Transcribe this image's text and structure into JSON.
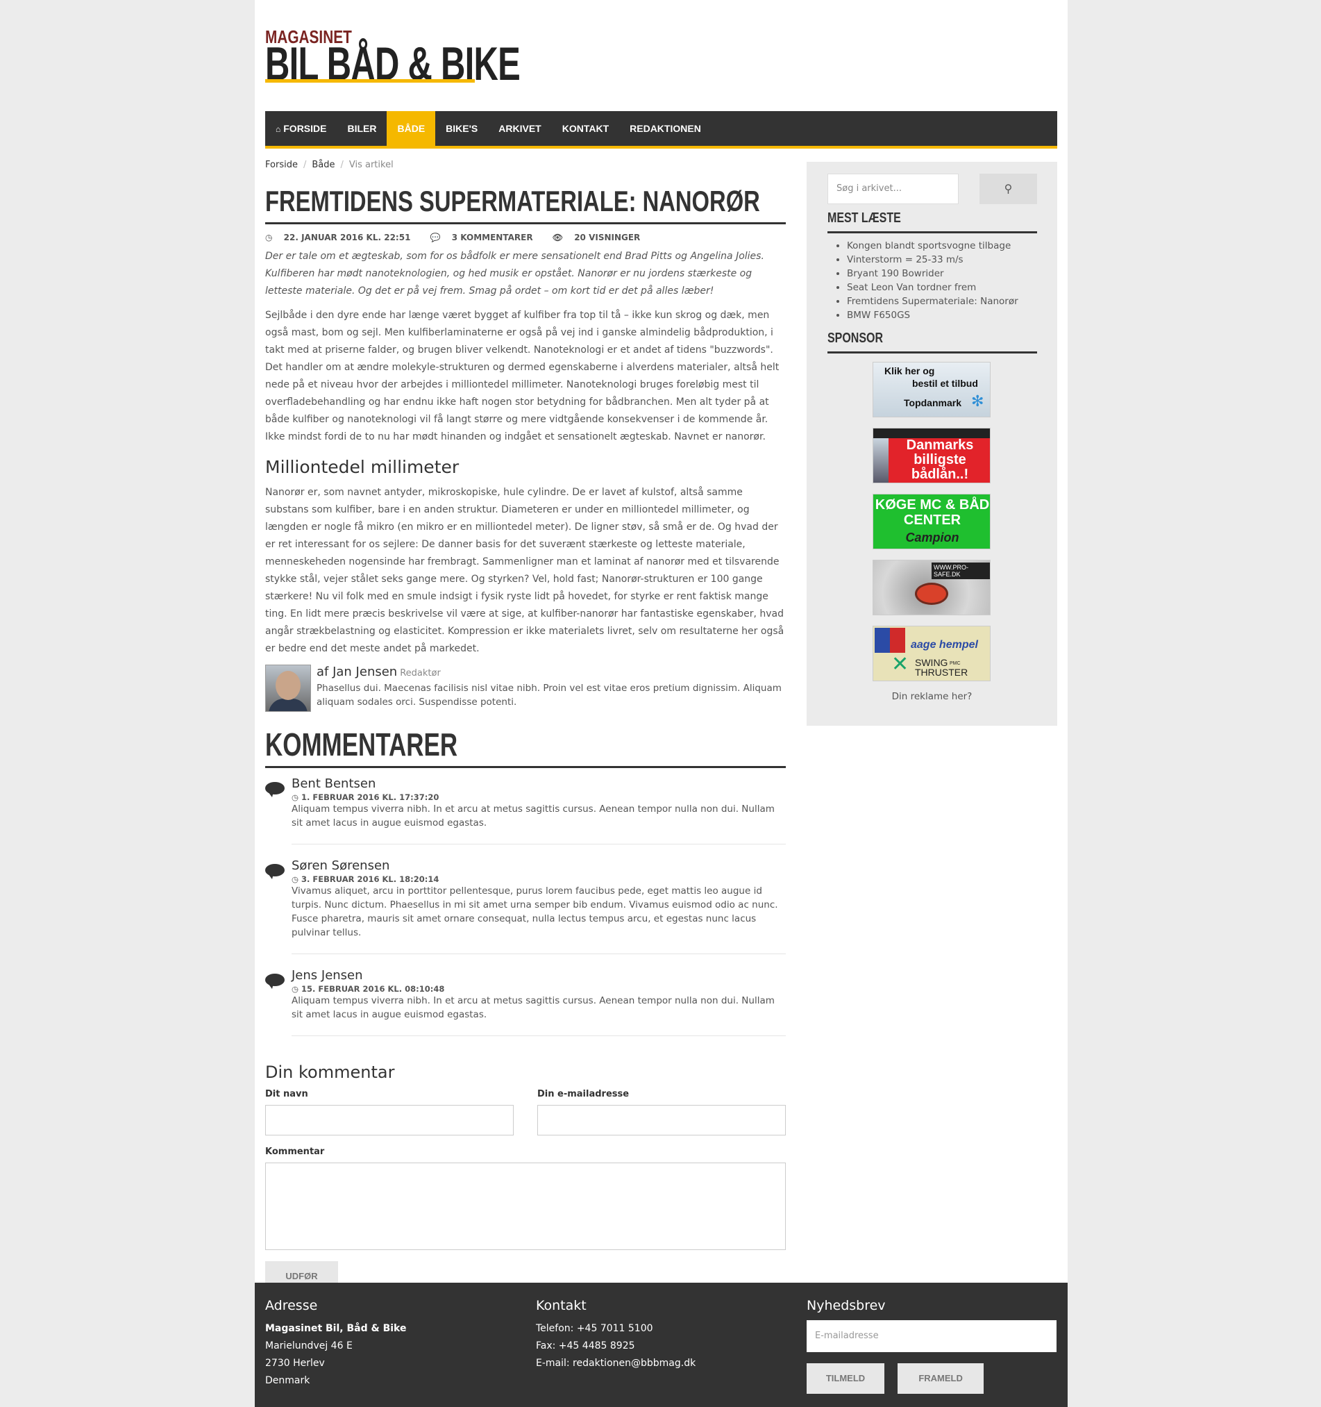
{
  "logo": {
    "small": "MAGASINET",
    "big": "BIL BÅD & BIKE"
  },
  "nav": [
    {
      "label": "FORSIDE",
      "icon": "home-icon",
      "active": false
    },
    {
      "label": "BILER",
      "active": false
    },
    {
      "label": "BÅDE",
      "active": true
    },
    {
      "label": "BIKE'S",
      "active": false
    },
    {
      "label": "ARKIVET",
      "active": false
    },
    {
      "label": "KONTAKT",
      "active": false
    },
    {
      "label": "REDAKTIONEN",
      "active": false
    }
  ],
  "breadcrumb": {
    "home": "Forside",
    "section": "Både",
    "current": "Vis artikel"
  },
  "article": {
    "title": "FREMTIDENS SUPERMATERIALE: NANORØR",
    "date": "22. JANUAR 2016 KL. 22:51",
    "comments": "3 KOMMENTARER",
    "views": "20 VISNINGER",
    "lead": "Der er tale om et ægteskab, som for os bådfolk er mere sensationelt end Brad Pitts og Angelina Jolies. Kulfiberen har mødt nanoteknologien, og hed musik er opstået. Nanorør er nu jordens stærkeste og letteste materiale. Og det er på vej frem. Smag på ordet – om kort tid er det på alles læber!",
    "paragraph1": "Sejlbåde i den dyre ende har længe været bygget af kulfiber fra top til tå – ikke kun skrog og dæk, men også mast, bom og sejl. Men kulfiberlaminaterne er også på vej ind i ganske almindelig bådproduktion, i takt med at priserne falder, og brugen bliver velkendt. Nanoteknologi er et andet af tidens \"buzzwords\". Det handler om at ændre molekyle-strukturen og dermed egenskaberne i alverdens materialer, altså helt nede på et niveau hvor der arbejdes i milliontedel millimeter. Nanoteknologi bruges foreløbig mest til overfladebehandling og har endnu ikke haft nogen stor betydning for bådbranchen. Men alt tyder på at både kulfiber og nanoteknologi vil få langt større og mere vidtgående konsekvenser i de kommende år. Ikke mindst fordi de to nu har mødt hinanden og indgået et sensationelt ægteskab. Navnet er nanorør.",
    "subheading": "Milliontedel millimeter",
    "paragraph2": "Nanorør er, som navnet antyder, mikroskopiske, hule cylindre. De er lavet af kulstof, altså samme substans som kulfiber, bare i en anden struktur. Diameteren er under en milliontedel millimeter, og længden er nogle få mikro (en mikro er en milliontedel meter). De ligner støv, så små er de. Og hvad der er ret interessant for os sejlere: De danner basis for det suverænt stærkeste og letteste materiale, menneskeheden nogensinde har frembragt. Sammenligner man et laminat af nanorør med et tilsvarende stykke stål, vejer stålet seks gange mere. Og styrken? Vel, hold fast; Nanorør-strukturen er 100 gange stærkere! Nu vil folk med en smule indsigt i fysik ryste lidt på hovedet, for styrke er rent faktisk mange ting. En lidt mere præcis beskrivelse vil være at sige, at kulfiber-nanorør har fantastiske egenskaber, hvad angår strækbelastning og elasticitet. Kompression er ikke materialets livret, selv om resultaterne her også er bedre end det meste andet på markedet."
  },
  "author": {
    "name": "af Jan Jensen",
    "role": "Redaktør",
    "bio": "Phasellus dui. Maecenas facilisis nisl vitae nibh. Proin vel est vitae eros pretium dignissim. Aliquam aliquam sodales orci. Suspendisse potenti."
  },
  "comments_title": "KOMMENTARER",
  "comments": [
    {
      "name": "Bent Bentsen",
      "date": "1. FEBRUAR 2016 KL. 17:37:20",
      "text": "Aliquam tempus viverra nibh. In et arcu at metus sagittis cursus. Aenean tempor nulla non dui. Nullam sit amet lacus in augue euismod egastas."
    },
    {
      "name": "Søren Sørensen",
      "date": "3. FEBRUAR 2016 KL. 18:20:14",
      "text": "Vivamus aliquet, arcu in porttitor pellentesque, purus lorem faucibus pede, eget mattis leo augue id turpis. Nunc dictum. Phaesellus in mi sit amet urna semper bib endum. Vivamus euismod odio ac nunc. Fusce pharetra, mauris sit amet ornare consequat, nulla lectus tempus arcu, et egestas nunc lacus pulvinar tellus."
    },
    {
      "name": "Jens Jensen",
      "date": "15. FEBRUAR 2016 KL. 08:10:48",
      "text": "Aliquam tempus viverra nibh. In et arcu at metus sagittis cursus. Aenean tempor nulla non dui. Nullam sit amet lacus in augue euismod egastas."
    }
  ],
  "form": {
    "title": "Din kommentar",
    "name_label": "Dit navn",
    "email_label": "Din e-mailadresse",
    "comment_label": "Kommentar",
    "submit": "UDFØR"
  },
  "sidebar": {
    "search_placeholder": "Søg i arkivet...",
    "mostread_title": "MEST LÆSTE",
    "mostread": [
      "Kongen blandt sportsvogne tilbage",
      "Vinterstorm = 25-33 m/s",
      "Bryant 190 Bowrider",
      "Seat Leon Van tordner frem",
      "Fremtidens Supermateriale: Nanorør",
      "BMW F650GS"
    ],
    "sponsor_title": "SPONSOR",
    "ads": {
      "topdanmark": {
        "line1": "Klik her og",
        "line2": "bestil et tilbud",
        "brand": "Topdanmark"
      },
      "billan": {
        "text": "Danmarks billigste bådlån..!"
      },
      "koge": {
        "line1": "KØGE MC & BÅD",
        "line2": "CENTER",
        "line3": "Campion"
      },
      "prosafe": {
        "text": "WWW.PRO-SAFE.DK"
      },
      "hempel": {
        "brand": "aage hempel",
        "line1": "SWING",
        "line2": "THRUSTER",
        "small": "PMC"
      }
    },
    "reklame": "Din reklame her?"
  },
  "footer": {
    "address_title": "Adresse",
    "address": [
      "Magasinet Bil, Båd & Bike",
      "Marielundvej 46 E",
      "2730 Herlev",
      "Denmark"
    ],
    "contact_title": "Kontakt",
    "contact": [
      "Telefon: +45 7011 5100",
      "Fax: +45 4485 8925",
      "E-mail: redaktionen@bbbmag.dk"
    ],
    "newsletter_title": "Nyhedsbrev",
    "newsletter_placeholder": "E-mailadresse",
    "subscribe": "TILMELD",
    "unsubscribe": "FRAMELD"
  },
  "colors": {
    "accent": "#f5b800",
    "dark": "#333333",
    "logo_red": "#7a2422"
  }
}
